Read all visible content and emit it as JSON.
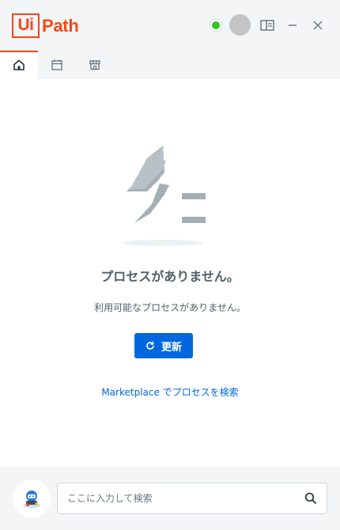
{
  "app": {
    "logo_boxed": "Ui",
    "logo_rest": "Path",
    "status_color": "#38c02a",
    "accent_color": "#fa4616",
    "primary_color": "#0067df"
  },
  "tabs": [
    {
      "icon": "home-icon",
      "active": true
    },
    {
      "icon": "calendar-icon",
      "active": false
    },
    {
      "icon": "store-icon",
      "active": false
    }
  ],
  "empty_state": {
    "title": "プロセスがありません。",
    "description": "利用可能なプロセスがありません。",
    "refresh_label": "更新",
    "marketplace_link": "Marketplace でプロセスを検索"
  },
  "footer": {
    "search_placeholder": "ここに入力して検索"
  }
}
